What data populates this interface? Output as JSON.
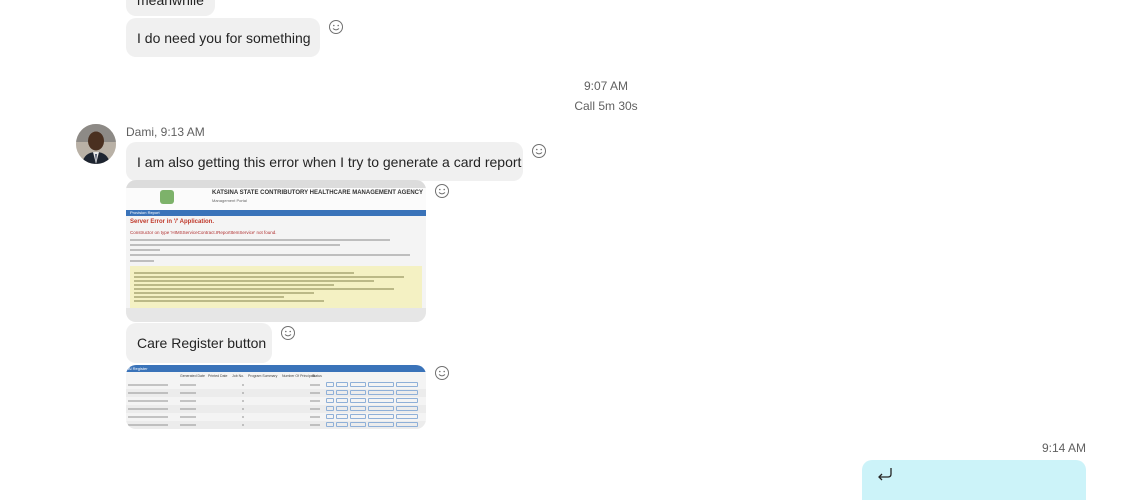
{
  "messages": {
    "prev_partial": "meanwhile",
    "need_you": "I do need you for something",
    "divider_time": "9:07 AM",
    "call_info": "Call 5m 30s",
    "sender": "Dami, 9:13 AM",
    "error_msg": "I am also getting this error when I try to generate a card report",
    "care_register": "Care Register button",
    "outgoing_time": "9:14 AM"
  },
  "screenshot1": {
    "agency_title": "KATSINA STATE CONTRIBUTORY HEALTHCARE MANAGEMENT AGENCY",
    "portal": "Management Portal",
    "nav": "Provision Report",
    "server_error": "Server Error in '/' Application.",
    "error_detail": "Constructor on type 'HIMSServiceContract.IReportItemService' not found."
  },
  "screenshot2": {
    "header": "Al Register",
    "columns": [
      "Generated Date",
      "Printed Date",
      "Job No.",
      "Program Summary",
      "Number Of Principals",
      "Status"
    ]
  },
  "colors": {
    "incoming_bubble": "#f0f0f0",
    "outgoing_bubble": "#ccf3f9",
    "meta_text": "#616161"
  }
}
